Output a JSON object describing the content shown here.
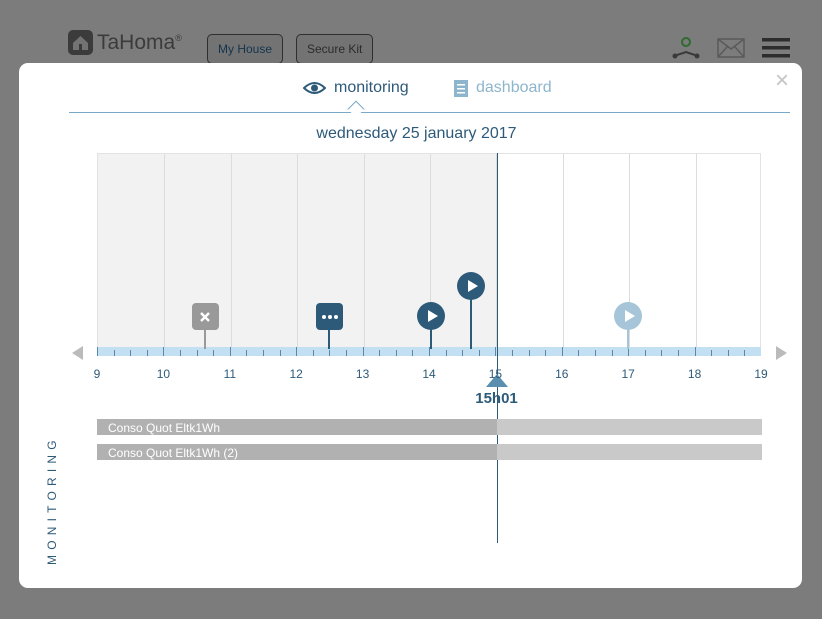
{
  "header": {
    "brand": "TaHoma",
    "registered": "®",
    "buttons": [
      "My House",
      "Secure Kit"
    ],
    "icons": [
      "user-network-icon",
      "mail-icon",
      "menu-icon"
    ]
  },
  "modal": {
    "close_label": "×",
    "tabs": [
      {
        "label": "monitoring",
        "icon": "eye-icon",
        "active": true
      },
      {
        "label": "dashboard",
        "icon": "document-icon",
        "active": false
      }
    ],
    "date": "wednesday 25 january 2017",
    "sidebar_label": "MONITORING"
  },
  "timeline": {
    "hour_labels": [
      "9",
      "10",
      "11",
      "12",
      "13",
      "14",
      "15",
      "16",
      "17",
      "18",
      "19"
    ],
    "range_hours": [
      9,
      19
    ],
    "now_hour": 15.017,
    "now_label": "15h01",
    "events": [
      {
        "type": "error",
        "icon": "close-icon",
        "hour": 10.62,
        "color": "#999999"
      },
      {
        "type": "pending",
        "icon": "more-icon",
        "hour": 12.5,
        "color": "#2d5a79"
      },
      {
        "type": "executed",
        "icon": "play-icon",
        "hour": 14.03,
        "color": "#2d5a79"
      },
      {
        "type": "executed",
        "icon": "play-icon",
        "hour": 14.63,
        "color": "#2d5a79",
        "raised": true
      },
      {
        "type": "scheduled",
        "icon": "play-icon",
        "hour": 17.0,
        "color": "#a6c5d8"
      }
    ],
    "arrows": {
      "left": "chevron-left-icon",
      "right": "chevron-right-icon"
    }
  },
  "monitoring_rows": [
    {
      "label": "Conso Quot Eltk1Wh"
    },
    {
      "label": "Conso Quot Eltk1Wh (2)"
    }
  ],
  "colors": {
    "accent": "#2d5a79",
    "axis": "#c3e0f3",
    "past_bg": "#f2f2f2"
  }
}
